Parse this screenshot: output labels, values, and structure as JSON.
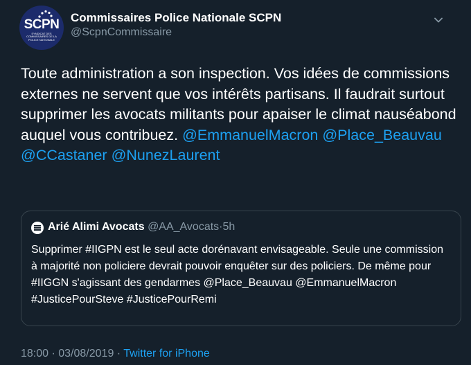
{
  "author": {
    "display_name": "Commissaires Police Nationale SCPN",
    "handle": "@ScpnCommissaire",
    "avatar_text": "SCPN",
    "avatar_subtext": "SYNDICAT DES COMMISSAIRES DE LA POLICE NATIONALE"
  },
  "tweet": {
    "text": "Toute administration a son inspection. Vos idées de commissions externes ne servent que vos intérêts partisans. Il faudrait surtout supprimer les avocats militants pour apaiser le climat nauséabond auquel vous contribuez.",
    "mentions": [
      "@EmmanuelMacron",
      "@Place_Beauvau",
      "@CCastaner",
      "@NunezLaurent"
    ]
  },
  "quoted": {
    "name": "Arié Alimi Avocats",
    "handle": "@AA_Avocats",
    "separator": "·",
    "time": "5h",
    "text": "Supprimer #IIGPN est le seul acte dorénavant envisageable. Seule une commission à majorité non policiere devrait pouvoir enquêter sur des policiers. De même pour #IIGGN s'agissant des gendarmes @Place_Beauvau @EmmanuelMacron #JusticePourSteve #JusticePourRemi"
  },
  "footer": {
    "timestamp": "18:00 · 03/08/2019 · ",
    "source": "Twitter for iPhone"
  },
  "colors": {
    "background": "#15202b",
    "link": "#1da1f2",
    "secondary": "#8899a6",
    "border": "#38444d"
  },
  "icons": [
    "chevron-down-icon",
    "avatar-logo"
  ]
}
